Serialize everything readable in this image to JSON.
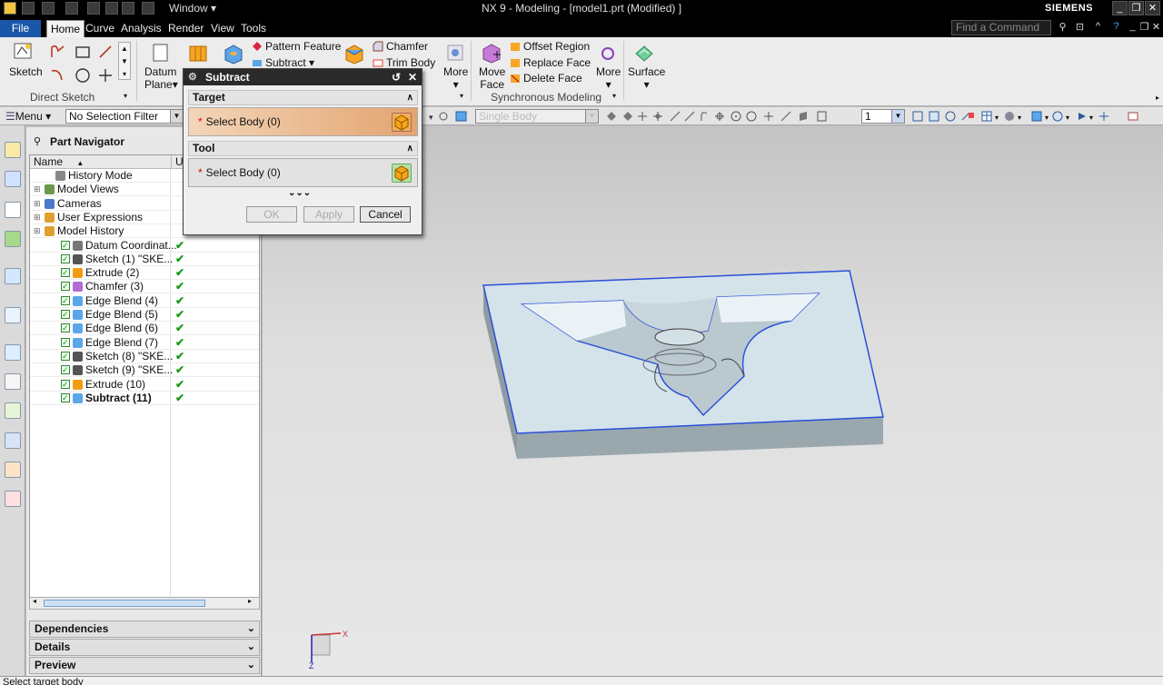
{
  "window": {
    "title": "NX 9 - Modeling - [model1.prt (Modified) ]",
    "brand": "SIEMENS",
    "window_menu": "Window"
  },
  "tabs": [
    "File",
    "Home",
    "Curve",
    "Analysis",
    "Render",
    "View",
    "Tools"
  ],
  "active_tab": "Home",
  "search": {
    "placeholder": "Find a Command"
  },
  "ribbon": {
    "sketch": "Sketch",
    "direct_sketch_group": "Direct Sketch",
    "datum_plane_1": "Datum",
    "datum_plane_2": "Plane",
    "pattern_feature": "Pattern Feature",
    "subtract": "Subtract",
    "chamfer": "Chamfer",
    "trim_body": "Trim Body",
    "more_feature": "More",
    "move_face_1": "Move",
    "move_face_2": "Face",
    "offset_region": "Offset Region",
    "replace_face": "Replace Face",
    "delete_face": "Delete Face",
    "more_sync": "More",
    "sync_group": "Synchronous Modeling",
    "surface": "Surface"
  },
  "selection_bar": {
    "menu": "Menu",
    "filter": "No Selection Filter",
    "scope": "Single Body",
    "layer": "1"
  },
  "navigator": {
    "title": "Part Navigator",
    "col_name": "Name",
    "col_up": "Up",
    "items": [
      {
        "label": "History Mode"
      },
      {
        "label": "Model Views"
      },
      {
        "label": "Cameras"
      },
      {
        "label": "User Expressions"
      },
      {
        "label": "Model History"
      },
      {
        "label": "Datum Coordinat..."
      },
      {
        "label": "Sketch (1) \"SKE..."
      },
      {
        "label": "Extrude (2)"
      },
      {
        "label": "Chamfer (3)"
      },
      {
        "label": "Edge Blend (4)"
      },
      {
        "label": "Edge Blend (5)"
      },
      {
        "label": "Edge Blend (6)"
      },
      {
        "label": "Edge Blend (7)"
      },
      {
        "label": "Sketch (8) \"SKE..."
      },
      {
        "label": "Sketch (9) \"SKE..."
      },
      {
        "label": "Extrude (10)"
      },
      {
        "label": "Subtract (11)"
      }
    ],
    "panes": [
      "Dependencies",
      "Details",
      "Preview"
    ]
  },
  "dialog": {
    "title": "Subtract",
    "target_section": "Target",
    "target_select": "Select Body (0)",
    "tool_section": "Tool",
    "tool_select": "Select Body (0)",
    "ok": "OK",
    "apply": "Apply",
    "cancel": "Cancel"
  },
  "status": {
    "prompt": "Select target body"
  },
  "colors": {
    "accent": "#1b57a8",
    "body_face": "#d5e3ea",
    "edge_highlight": "#2a4fd8",
    "target_highlight": "#e6b07f"
  }
}
